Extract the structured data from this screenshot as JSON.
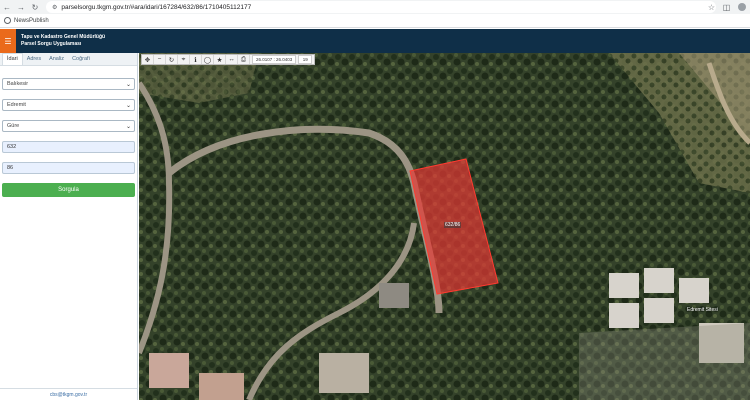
{
  "browser": {
    "url": "parselsorgu.tkgm.gov.tr/#ara/idari/167284/632/86/1710405112177",
    "bookmark": "NewsPublish",
    "icons": [
      "back-icon",
      "forward-icon",
      "reload-icon",
      "site-info-icon",
      "star-icon",
      "sidebar-icon",
      "profile-icon"
    ]
  },
  "header": {
    "title_line1": "Tapu ve Kadastro Genel Müdürlüğü",
    "title_line2": "Parsel Sorgu Uygulaması"
  },
  "sidebar": {
    "tabs": [
      {
        "label": "İdari",
        "active": true
      },
      {
        "label": "Adres"
      },
      {
        "label": "Analiz"
      },
      {
        "label": "Coğrafi"
      }
    ],
    "fields": {
      "province": "Balıkesir",
      "district": "Edremit",
      "neighborhood": "Güre",
      "block": "632",
      "parcel": "86"
    },
    "query_button": "Sorgula",
    "footer_email": "cbs@tkgm.gov.tr"
  },
  "map": {
    "scale_text": "26.0107 : 26.0403",
    "zoom_text": "19",
    "parcel_label": "632/86",
    "place_label": "Edremit Sitesi",
    "parcel_color": "#e53935",
    "tools": [
      "pan-icon",
      "zoom-out-icon",
      "refresh-icon",
      "locate-icon",
      "info-icon",
      "measure-icon",
      "favorite-icon",
      "distance-icon",
      "print-icon"
    ]
  }
}
